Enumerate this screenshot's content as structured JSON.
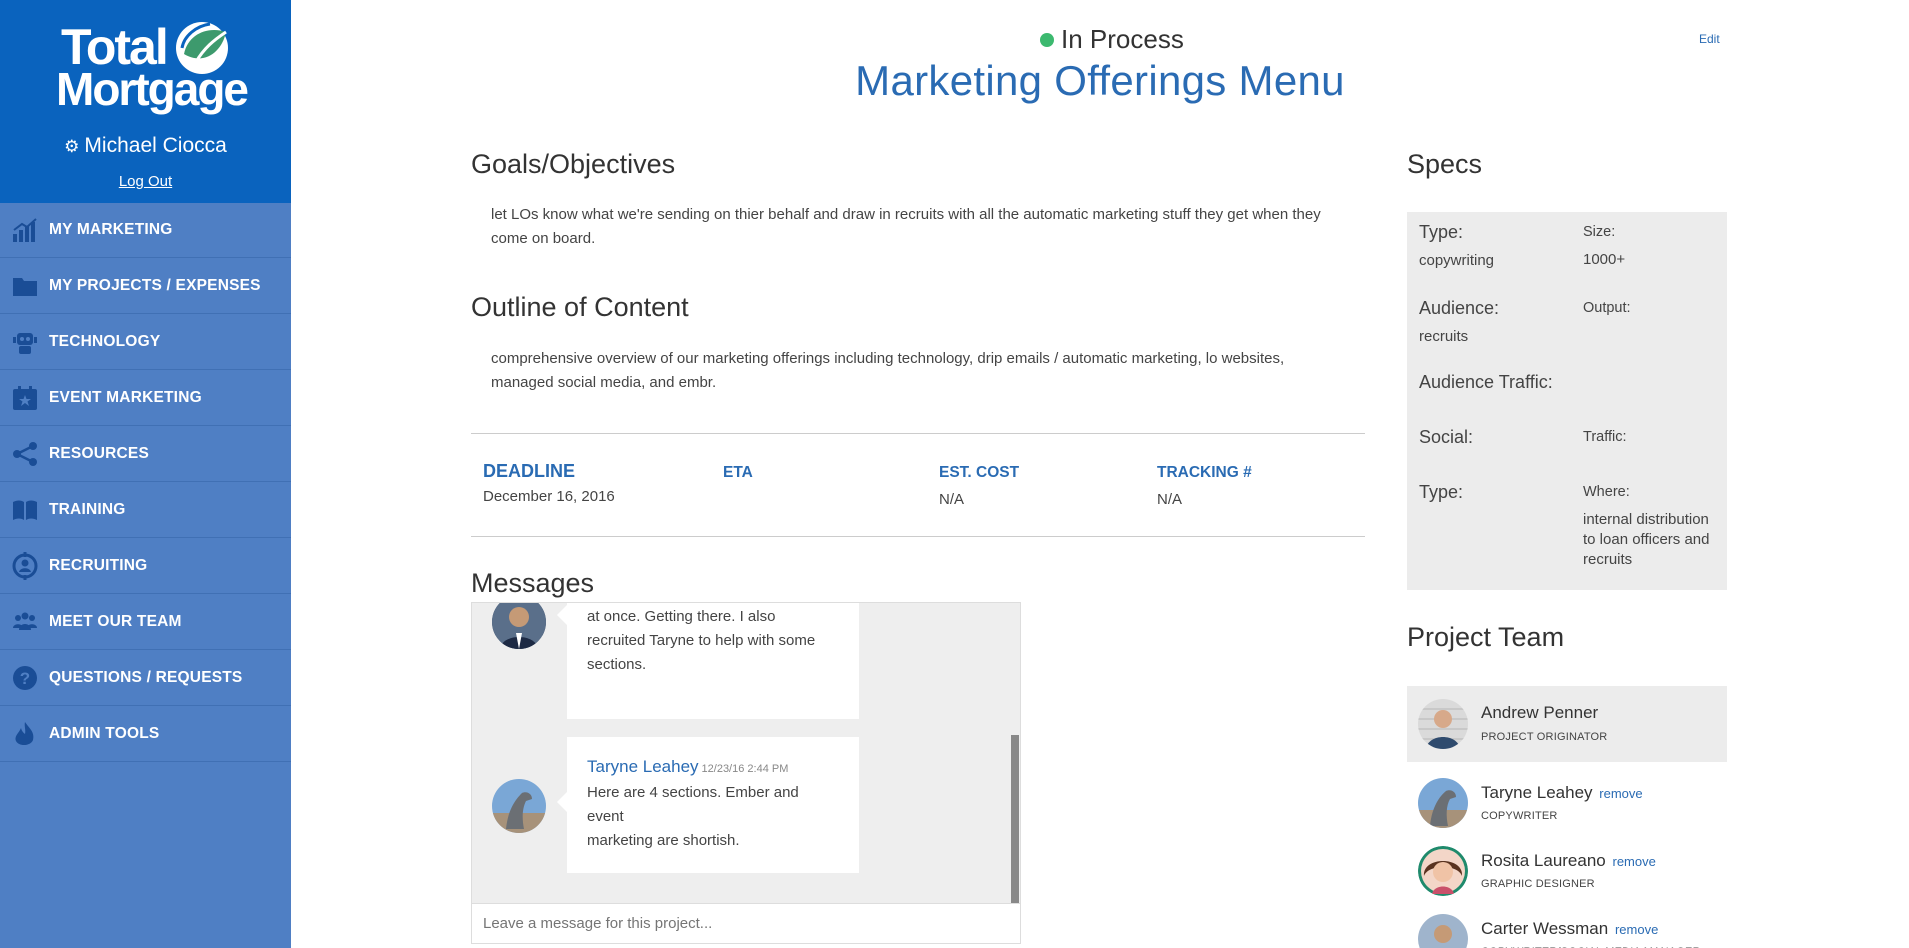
{
  "brand": {
    "logo_line1": "Total",
    "logo_line2": "Mortgage",
    "accent": "#0a63be"
  },
  "user": {
    "name": "Michael Ciocca",
    "logout_label": "Log Out"
  },
  "nav": {
    "items": [
      {
        "label": "MY MARKETING",
        "icon": "chart-icon"
      },
      {
        "label": "MY PROJECTS / EXPENSES",
        "icon": "folder-icon"
      },
      {
        "label": "TECHNOLOGY",
        "icon": "robot-icon"
      },
      {
        "label": "EVENT MARKETING",
        "icon": "calendar-icon"
      },
      {
        "label": "RESOURCES",
        "icon": "share-icon"
      },
      {
        "label": "TRAINING",
        "icon": "book-icon"
      },
      {
        "label": "RECRUITING",
        "icon": "recruit-icon"
      },
      {
        "label": "MEET OUR TEAM",
        "icon": "team-icon"
      },
      {
        "label": "QUESTIONS / REQUESTS",
        "icon": "question-icon"
      },
      {
        "label": "ADMIN TOOLS",
        "icon": "flame-icon"
      }
    ]
  },
  "project": {
    "status": "In Process",
    "status_color": "#3cb96f",
    "edit_label": "Edit",
    "title": "Marketing Offerings Menu",
    "goals_heading": "Goals/Objectives",
    "goals_line1": "let LOs know what we're sending on thier behalf and draw in recruits with all the automatic marketing stuff they get when they",
    "goals_line2": "come on board.",
    "outline_heading": "Outline of Content",
    "outline_line1": "comprehensive overview of our marketing offerings including technology, drip emails / automatic marketing, lo websites,",
    "outline_line2": "managed social media, and embr."
  },
  "deadline": {
    "deadline_label": "DEADLINE",
    "deadline_value": "December 16, 2016",
    "eta_label": "ETA",
    "eta_value": "",
    "cost_label": "EST. COST",
    "cost_value": "N/A",
    "tracking_label": "TRACKING #",
    "tracking_value": "N/A"
  },
  "messages": {
    "heading": "Messages",
    "items": [
      {
        "author": "",
        "time": "",
        "line1": "at once. Getting there. I also",
        "line2": "recruited Taryne to help with some",
        "line3": "sections."
      },
      {
        "author": "Taryne Leahey",
        "time": "12/23/16 2:44 PM",
        "line1": "Here are 4 sections. Ember and event",
        "line2": "marketing are shortish.",
        "line3": ""
      }
    ],
    "input_placeholder": "Leave a message for this project..."
  },
  "specs": {
    "heading": "Specs",
    "type_label": "Type:",
    "type_value": "copywriting",
    "size_label": "Size:",
    "size_value": "1000+",
    "audience_label": "Audience:",
    "audience_value": "recruits",
    "output_label": "Output:",
    "audience_traffic_label": "Audience Traffic:",
    "social_label": "Social:",
    "traffic_label": "Traffic:",
    "type2_label": "Type:",
    "where_label": "Where:",
    "where_line1": "internal distribution",
    "where_line2": "to loan officers and",
    "where_line3": "recruits"
  },
  "team": {
    "heading": "Project Team",
    "remove_label": "remove",
    "members": [
      {
        "name": "Andrew Penner",
        "role": "PROJECT ORIGINATOR"
      },
      {
        "name": "Taryne Leahey",
        "role": "COPYWRITER"
      },
      {
        "name": "Rosita Laureano",
        "role": "GRAPHIC DESIGNER"
      },
      {
        "name": "Carter Wessman",
        "role": "COPYWRITER/SOCIAL MEDIA MANAGER"
      }
    ]
  }
}
